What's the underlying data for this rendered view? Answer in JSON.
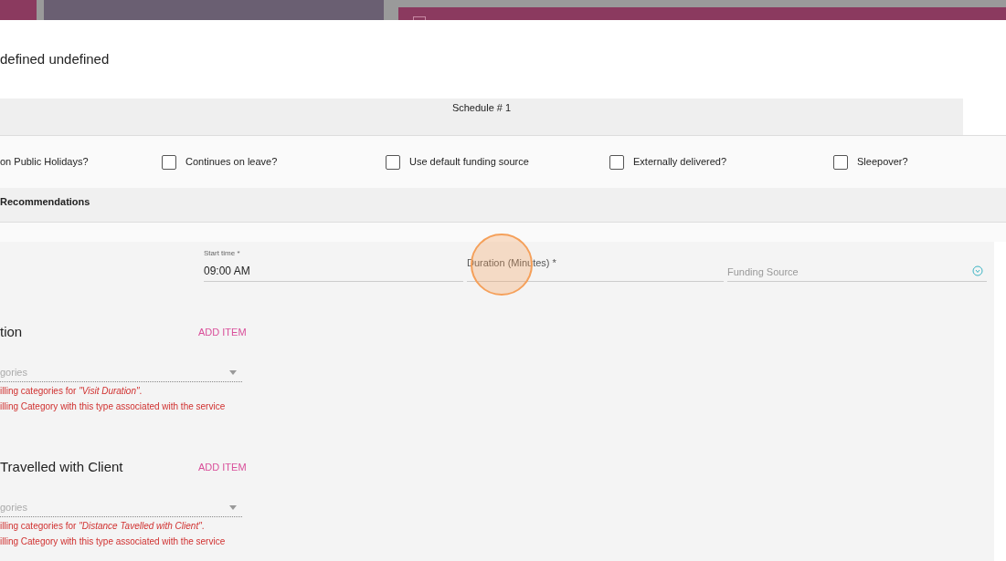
{
  "modal": {
    "title": "defined undefined",
    "schedule_label": "Schedule # 1",
    "options": [
      {
        "kind": "text",
        "label": "on Public Holidays?"
      },
      {
        "kind": "checkbox",
        "label": "Continues on leave?",
        "checked": false
      },
      {
        "kind": "checkbox",
        "label": "Use default funding source",
        "checked": false
      },
      {
        "kind": "checkbox",
        "label": "Externally delivered?",
        "checked": false
      },
      {
        "kind": "checkbox",
        "label": "Sleepover?",
        "checked": false
      }
    ],
    "recommendations_heading": "Recommendations",
    "fields": [
      {
        "kind": "text",
        "label": "Start time *",
        "value": "09:00 AM"
      },
      {
        "kind": "text",
        "placeholder": "Duration (Minutes) *"
      },
      {
        "kind": "select",
        "placeholder": "Funding Source"
      }
    ],
    "sections": [
      {
        "title": "tion",
        "action": "ADD ITEM",
        "dropdown_placeholder": "gories",
        "errors": [
          "illing categories for *\"Visit Duration\"*.",
          "illing Category with this type associated with the service"
        ]
      },
      {
        "title": "Travelled with Client",
        "action": "ADD ITEM",
        "dropdown_placeholder": "gories",
        "errors": [
          "illing categories for *\"Distance Tavelled with Client\"*.",
          "illing Category with this type associated with the service"
        ]
      }
    ],
    "click_marker": true
  }
}
